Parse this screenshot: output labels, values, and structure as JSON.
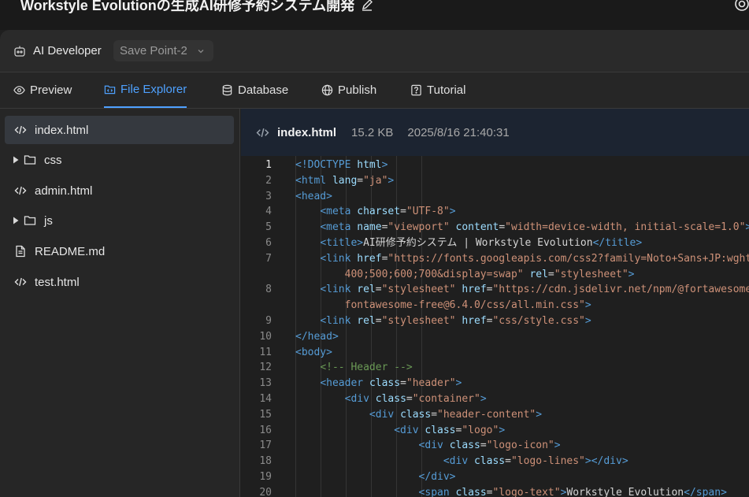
{
  "window": {
    "title": "Workstyle Evolutionの生成AI研修予約システム開発"
  },
  "toolbar": {
    "agent_label": "AI Developer",
    "save_point": "Save Point-2"
  },
  "tabs": [
    {
      "label": "Preview",
      "icon": "eye-icon"
    },
    {
      "label": "File Explorer",
      "icon": "folder-code-icon"
    },
    {
      "label": "Database",
      "icon": "database-icon"
    },
    {
      "label": "Publish",
      "icon": "globe-icon"
    },
    {
      "label": "Tutorial",
      "icon": "help-icon"
    }
  ],
  "active_tab": "File Explorer",
  "files": [
    {
      "name": "index.html",
      "type": "code-file",
      "active": true
    },
    {
      "name": "css",
      "type": "folder"
    },
    {
      "name": "admin.html",
      "type": "code-file"
    },
    {
      "name": "js",
      "type": "folder"
    },
    {
      "name": "README.md",
      "type": "document-file"
    },
    {
      "name": "test.html",
      "type": "code-file"
    }
  ],
  "editor": {
    "file_name": "index.html",
    "file_size": "15.2 KB",
    "modified": "2025/8/16 21:40:31",
    "active_line": 1,
    "line_numbers": [
      "1",
      "2",
      "3",
      "4",
      "5",
      "6",
      "7",
      "",
      "8",
      "",
      "9",
      "10",
      "11",
      "12",
      "13",
      "14",
      "15",
      "16",
      "17",
      "18",
      "19",
      "20"
    ],
    "lines": [
      [
        [
          "tg",
          "<!DOCTYPE "
        ],
        [
          "at",
          "html"
        ],
        [
          "tg",
          ">"
        ]
      ],
      [
        [
          "tg",
          "<html "
        ],
        [
          "at",
          "lang"
        ],
        [
          "tx",
          "="
        ],
        [
          "sv",
          "\"ja\""
        ],
        [
          "tg",
          ">"
        ]
      ],
      [
        [
          "tg",
          "<head>"
        ]
      ],
      [
        [
          "tx",
          "    "
        ],
        [
          "tg",
          "<meta "
        ],
        [
          "at",
          "charset"
        ],
        [
          "tx",
          "="
        ],
        [
          "sv",
          "\"UTF-8\""
        ],
        [
          "tg",
          ">"
        ]
      ],
      [
        [
          "tx",
          "    "
        ],
        [
          "tg",
          "<meta "
        ],
        [
          "at",
          "name"
        ],
        [
          "tx",
          "="
        ],
        [
          "sv",
          "\"viewport\""
        ],
        [
          "tx",
          " "
        ],
        [
          "at",
          "content"
        ],
        [
          "tx",
          "="
        ],
        [
          "sv",
          "\"width=device-width, initial-scale=1.0\""
        ],
        [
          "tg",
          ">"
        ]
      ],
      [
        [
          "tx",
          "    "
        ],
        [
          "tg",
          "<title>"
        ],
        [
          "tx",
          "AI研修予約システム | Workstyle Evolution"
        ],
        [
          "tg",
          "</title>"
        ]
      ],
      [
        [
          "tx",
          "    "
        ],
        [
          "tg",
          "<link "
        ],
        [
          "at",
          "href"
        ],
        [
          "tx",
          "="
        ],
        [
          "sv",
          "\"https://fonts.googleapis.com/css2?family=Noto+Sans+JP:wght@"
        ]
      ],
      [
        [
          "tx",
          "        "
        ],
        [
          "sv",
          "400;500;600;700&display=swap\""
        ],
        [
          "tx",
          " "
        ],
        [
          "at",
          "rel"
        ],
        [
          "tx",
          "="
        ],
        [
          "sv",
          "\"stylesheet\""
        ],
        [
          "tg",
          ">"
        ]
      ],
      [
        [
          "tx",
          "    "
        ],
        [
          "tg",
          "<link "
        ],
        [
          "at",
          "rel"
        ],
        [
          "tx",
          "="
        ],
        [
          "sv",
          "\"stylesheet\""
        ],
        [
          "tx",
          " "
        ],
        [
          "at",
          "href"
        ],
        [
          "tx",
          "="
        ],
        [
          "sv",
          "\"https://cdn.jsdelivr.net/npm/@fortawesome/"
        ]
      ],
      [
        [
          "tx",
          "        "
        ],
        [
          "sv",
          "fontawesome-free@6.4.0/css/all.min.css\""
        ],
        [
          "tg",
          ">"
        ]
      ],
      [
        [
          "tx",
          "    "
        ],
        [
          "tg",
          "<link "
        ],
        [
          "at",
          "rel"
        ],
        [
          "tx",
          "="
        ],
        [
          "sv",
          "\"stylesheet\""
        ],
        [
          "tx",
          " "
        ],
        [
          "at",
          "href"
        ],
        [
          "tx",
          "="
        ],
        [
          "sv",
          "\"css/style.css\""
        ],
        [
          "tg",
          ">"
        ]
      ],
      [
        [
          "tg",
          "</head>"
        ]
      ],
      [
        [
          "tg",
          "<body>"
        ]
      ],
      [
        [
          "tx",
          "    "
        ],
        [
          "cm",
          "<!-- Header -->"
        ]
      ],
      [
        [
          "tx",
          "    "
        ],
        [
          "tg",
          "<header "
        ],
        [
          "at",
          "class"
        ],
        [
          "tx",
          "="
        ],
        [
          "sv",
          "\"header\""
        ],
        [
          "tg",
          ">"
        ]
      ],
      [
        [
          "tx",
          "        "
        ],
        [
          "tg",
          "<div "
        ],
        [
          "at",
          "class"
        ],
        [
          "tx",
          "="
        ],
        [
          "sv",
          "\"container\""
        ],
        [
          "tg",
          ">"
        ]
      ],
      [
        [
          "tx",
          "            "
        ],
        [
          "tg",
          "<div "
        ],
        [
          "at",
          "class"
        ],
        [
          "tx",
          "="
        ],
        [
          "sv",
          "\"header-content\""
        ],
        [
          "tg",
          ">"
        ]
      ],
      [
        [
          "tx",
          "                "
        ],
        [
          "tg",
          "<div "
        ],
        [
          "at",
          "class"
        ],
        [
          "tx",
          "="
        ],
        [
          "sv",
          "\"logo\""
        ],
        [
          "tg",
          ">"
        ]
      ],
      [
        [
          "tx",
          "                    "
        ],
        [
          "tg",
          "<div "
        ],
        [
          "at",
          "class"
        ],
        [
          "tx",
          "="
        ],
        [
          "sv",
          "\"logo-icon\""
        ],
        [
          "tg",
          ">"
        ]
      ],
      [
        [
          "tx",
          "                        "
        ],
        [
          "tg",
          "<div "
        ],
        [
          "at",
          "class"
        ],
        [
          "tx",
          "="
        ],
        [
          "sv",
          "\"logo-lines\""
        ],
        [
          "tg",
          "></div>"
        ]
      ],
      [
        [
          "tx",
          "                    "
        ],
        [
          "tg",
          "</div>"
        ]
      ],
      [
        [
          "tx",
          "                    "
        ],
        [
          "tg",
          "<span "
        ],
        [
          "at",
          "class"
        ],
        [
          "tx",
          "="
        ],
        [
          "sv",
          "\"logo-text\""
        ],
        [
          "tg",
          ">"
        ],
        [
          "tx",
          "Workstyle Evolution"
        ],
        [
          "tg",
          "</span>"
        ]
      ]
    ]
  }
}
